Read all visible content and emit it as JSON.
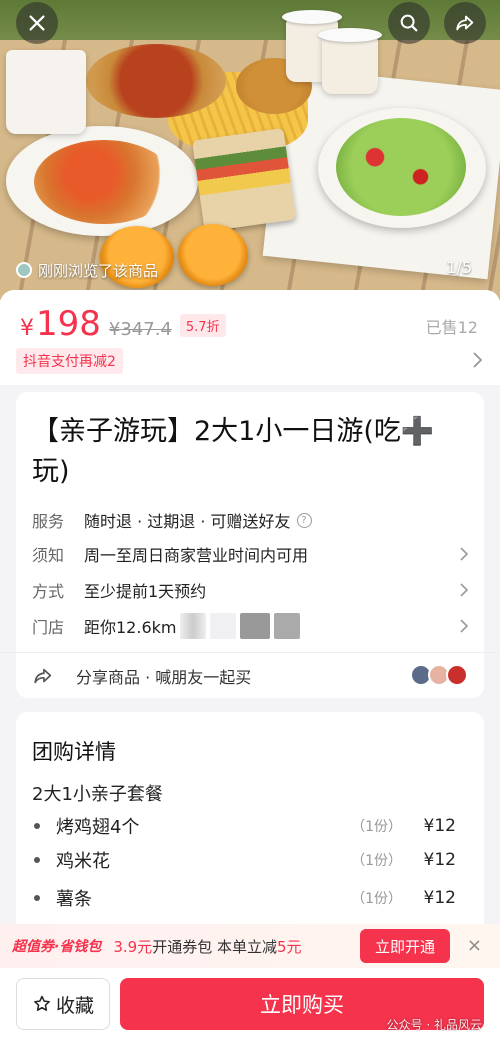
{
  "hero": {
    "viewed_label": "刚刚浏览了该商品",
    "pager": "1/5"
  },
  "price": {
    "currency": "¥",
    "current": "198",
    "original": "¥347.4",
    "discount": "5.7折",
    "sold": "已售12",
    "promo": "抖音支付再减2"
  },
  "product": {
    "title": "【亲子游玩】2大1小一日游(吃➕玩)",
    "service_key": "服务",
    "service_value": "随时退 · 过期退 · 可赠送好友",
    "notice_key": "须知",
    "notice_value": "周一至周日商家营业时间内可用",
    "method_key": "方式",
    "method_value": "至少提前1天预约",
    "store_key": "门店",
    "store_value": "距你12.6km",
    "share_label": "分享商品 · 喊朋友一起买"
  },
  "detail": {
    "title": "团购详情",
    "package_name": "2大1小亲子套餐",
    "items": [
      {
        "name": "烤鸡翅4个",
        "qty": "（1份）",
        "price": "¥12"
      },
      {
        "name": "鸡米花",
        "qty": "（1份）",
        "price": "¥12"
      },
      {
        "name": "薯条",
        "qty": "（1份）",
        "price": "¥12"
      }
    ]
  },
  "coupon": {
    "brand": "超值券·省钱包",
    "amount": "3.9元",
    "text_mid": "开通券包 本单立减",
    "reduce": "5元",
    "button": "立即开通",
    "close": "×"
  },
  "bottom": {
    "favorite": "收藏",
    "buy": "立即购买",
    "watermark": "公众号 · 礼品风云"
  },
  "colors": {
    "accent": "#f5334d"
  }
}
